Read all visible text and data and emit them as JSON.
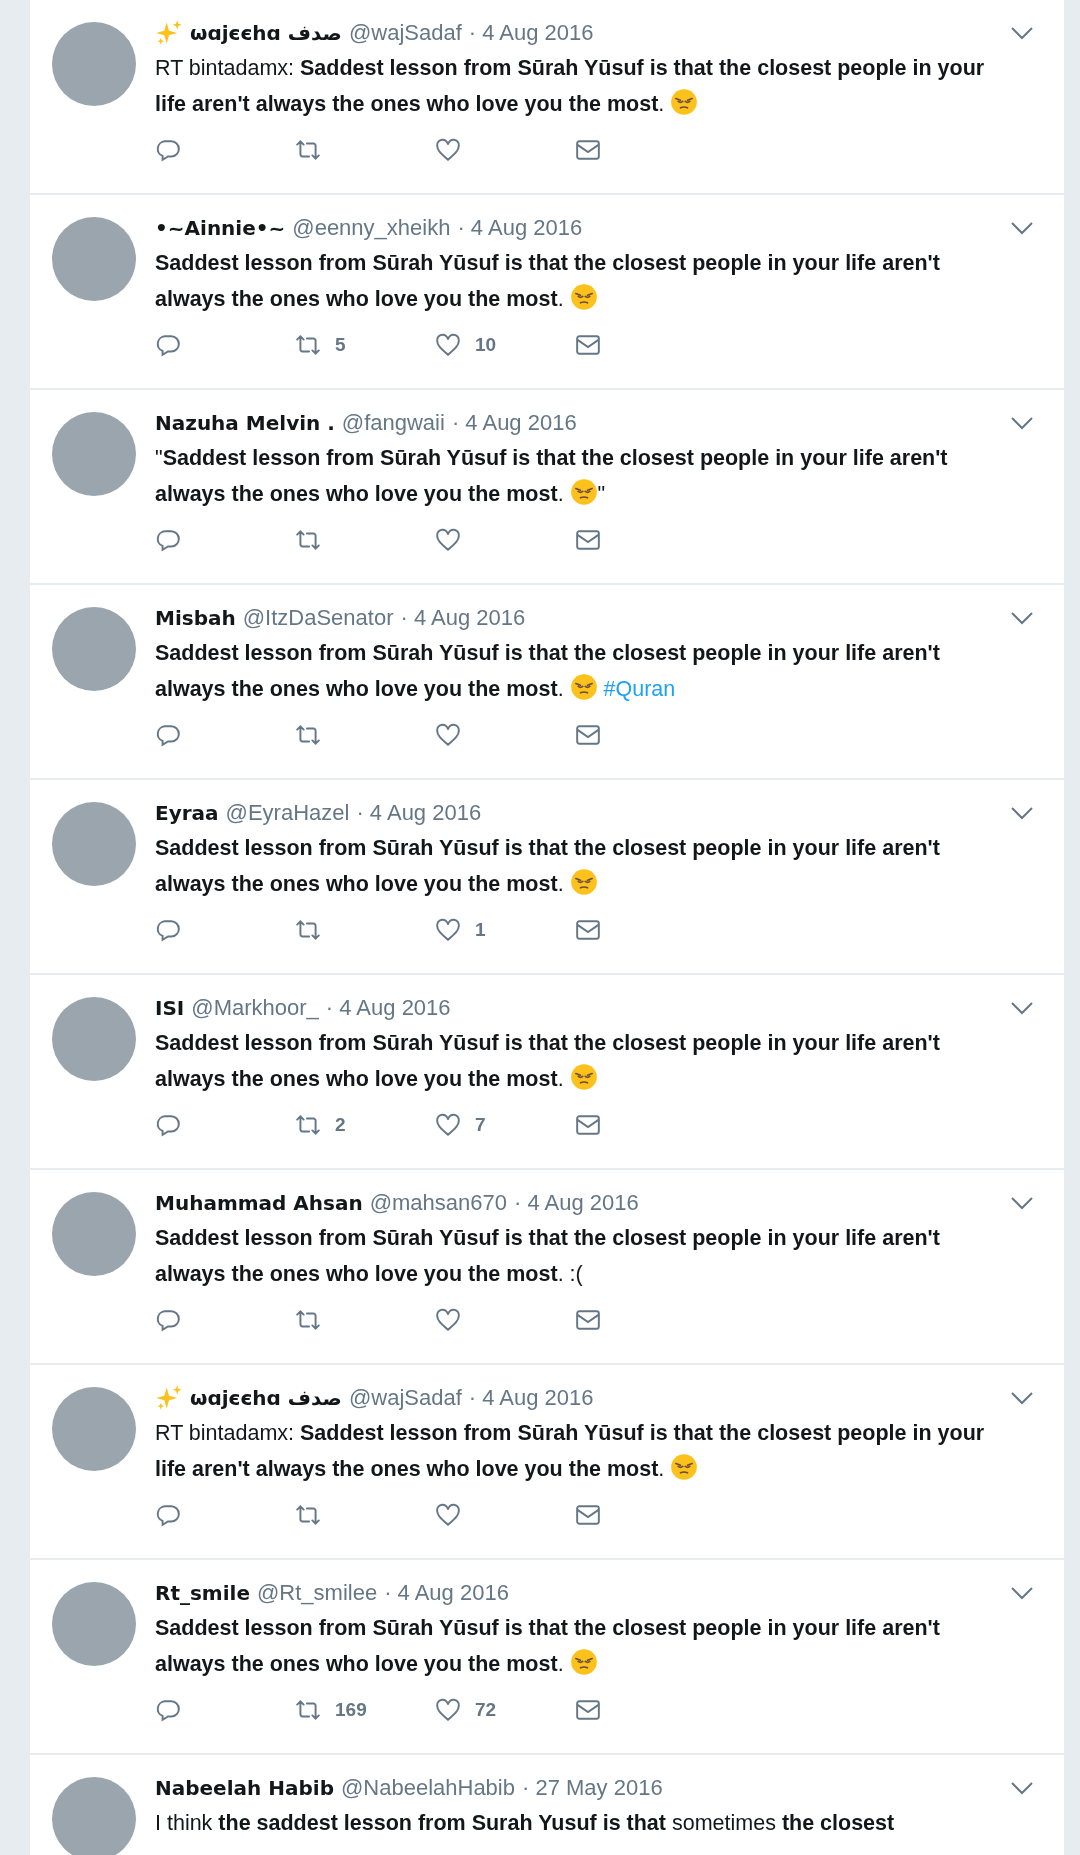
{
  "tweets": [
    {
      "sparkle": true,
      "name": "ωɑjєєhɑ صدف",
      "handle": "@wajSadaf",
      "date": "· 4 Aug 2016",
      "text": "RT bintadamx: **Saddest lesson from Sūrah Yūsuf is that the closest people in your life aren't always the ones who love you the most**.",
      "emoji": true
    },
    {
      "sparkle": false,
      "name": "•~Ainnie•~",
      "handle": "@eenny_xheikh",
      "date": "· 4 Aug 2016",
      "text": "**Saddest lesson from Sūrah Yūsuf is that the closest people in your life aren't always the ones who love you the most**.",
      "emoji": true,
      "retweets": "5",
      "likes": "10"
    },
    {
      "sparkle": false,
      "name": "Nazuha Melvin .",
      "handle": "@fangwaii",
      "date": "· 4 Aug 2016",
      "text": "\"**Saddest lesson from Sūrah Yūsuf is that the closest people in your life aren't always the ones who love you the most**.",
      "emoji": true,
      "after": "\""
    },
    {
      "sparkle": false,
      "name": "Misbah",
      "handle": "@ItzDaSenator",
      "date": "· 4 Aug 2016",
      "text": "**Saddest lesson from Sūrah Yūsuf is that the closest people in your life aren't always the ones who love you the most**.",
      "emoji": true,
      "hashtag": "#Quran"
    },
    {
      "sparkle": false,
      "name": "Eyraa",
      "handle": "@EyraHazel",
      "date": "· 4 Aug 2016",
      "text": "**Saddest lesson from Sūrah Yūsuf is that the closest people in your life aren't always the ones who love you the most**.",
      "emoji": true,
      "likes": "1"
    },
    {
      "sparkle": false,
      "name": "ISI",
      "handle": "@Markhoor_",
      "date": "· 4 Aug 2016",
      "text": "**Saddest lesson from Sūrah Yūsuf is that the closest people in your life aren't always the ones who love you the most**.",
      "emoji": true,
      "retweets": "2",
      "likes": "7"
    },
    {
      "sparkle": false,
      "name": "Muhammad Ahsan",
      "handle": "@mahsan670",
      "date": "· 4 Aug 2016",
      "text": "**Saddest lesson from Sūrah Yūsuf is that the closest people in your life aren't always the ones who love you the most**. :(",
      "emoji": false
    },
    {
      "sparkle": true,
      "name": "ωɑjєєhɑ صدف",
      "handle": "@wajSadaf",
      "date": "· 4 Aug 2016",
      "text": "RT bintadamx: **Saddest lesson from Sūrah Yūsuf is that the closest people in your life aren't always the ones who love you the most**.",
      "emoji": true
    },
    {
      "sparkle": false,
      "name": "Rt_smile",
      "handle": "@Rt_smilee",
      "date": "· 4 Aug 2016",
      "text": "**Saddest lesson from Sūrah Yūsuf is that the closest people in your life aren't always the ones who love you the most**.",
      "emoji": true,
      "retweets": "169",
      "likes": "72"
    },
    {
      "sparkle": false,
      "name": "Nabeelah Habib",
      "handle": "@NabeelahHabib",
      "date": "· 27 May 2016",
      "text": "I think **the saddest lesson from Surah Yusuf is that** sometimes **the closest**",
      "emoji": false
    }
  ]
}
